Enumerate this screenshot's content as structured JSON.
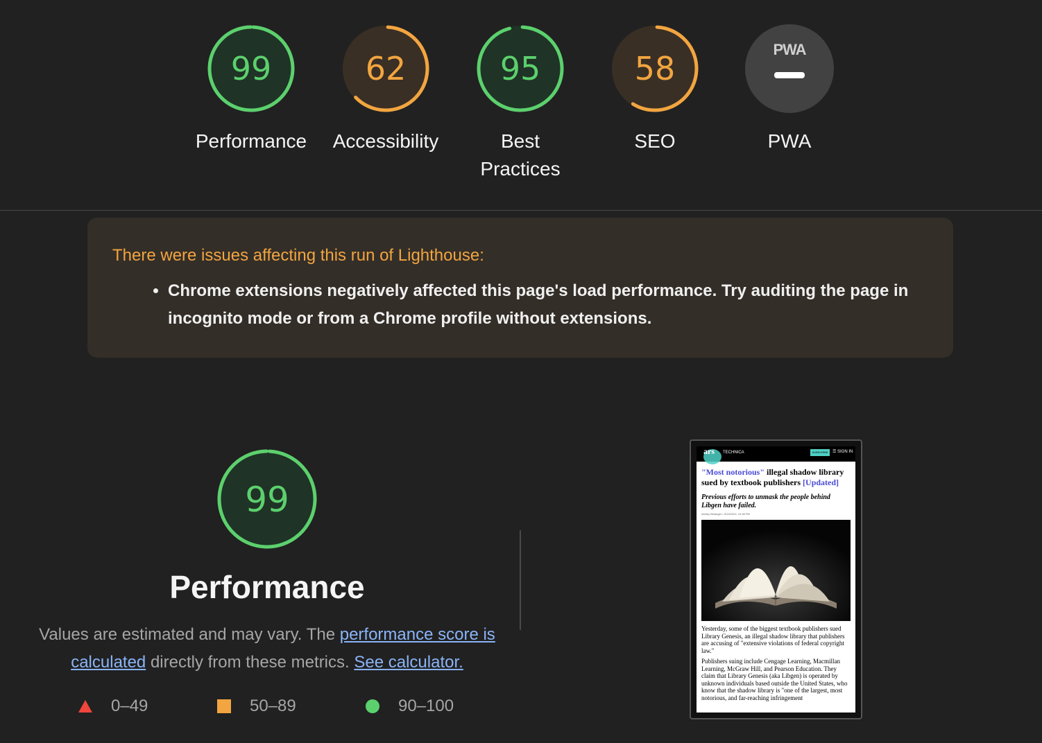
{
  "colors": {
    "pass": "#5cd06d",
    "average": "#f2a540",
    "fail": "#f0463c",
    "link": "#8ab4f8",
    "background": "#212121"
  },
  "categories": [
    {
      "score": "99",
      "label": "Performance",
      "level": 0.99,
      "rating": "pass"
    },
    {
      "score": "62",
      "label": "Accessibility",
      "level": 0.62,
      "rating": "average"
    },
    {
      "score": "95",
      "label": "Best Practices",
      "level": 0.95,
      "rating": "pass"
    },
    {
      "score": "58",
      "label": "SEO",
      "level": 0.58,
      "rating": "average"
    },
    {
      "score": "",
      "label": "PWA",
      "badge": "PWA",
      "rating": "na"
    }
  ],
  "warning": {
    "title": "There were issues affecting this run of Lighthouse:",
    "items": [
      "Chrome extensions negatively affected this page's load performance. Try auditing the page in incognito mode or from a Chrome profile without extensions."
    ]
  },
  "performance": {
    "score": "99",
    "level": 0.99,
    "title": "Performance",
    "desc_part1": "Values are estimated and may vary. The ",
    "desc_link1": "performance score is calculated",
    "desc_part2": " directly from these metrics. ",
    "desc_link2": "See calculator."
  },
  "legend": [
    {
      "range": "0–49",
      "shape": "triangle",
      "color": "#f0463c"
    },
    {
      "range": "50–89",
      "shape": "square",
      "color": "#f2a540"
    },
    {
      "range": "90–100",
      "shape": "circle",
      "color": "#5cd06d"
    }
  ],
  "screenshot": {
    "logo": "ars",
    "logo_tag": "TECHNICA",
    "subscribe": "SUBSCRIBE",
    "menu": "SIGN IN",
    "quote_word": "\"Most notorious\"",
    "headline_rest": " illegal shadow library sued by textbook publishers ",
    "updated": "[Updated]",
    "subhead": "Previous efforts to unmask the people behind Libgen have failed.",
    "byline": "Ashley Belanger • 9/13/2022, 10:48 PM",
    "para1": "Yesterday, some of the biggest textbook publishers sued Library Genesis, an illegal shadow library that publishers are accusing of \"extensive violations of federal copyright law.\"",
    "para2": "Publishers suing include Cengage Learning, Macmillan Learning, McGraw Hill, and Pearson Education. They claim that Library Genesis (aka Libgen) is operated by unknown individuals based outside the United States, who know that the shadow library is \"one of the largest, most notorious, and far-reaching infringement"
  }
}
